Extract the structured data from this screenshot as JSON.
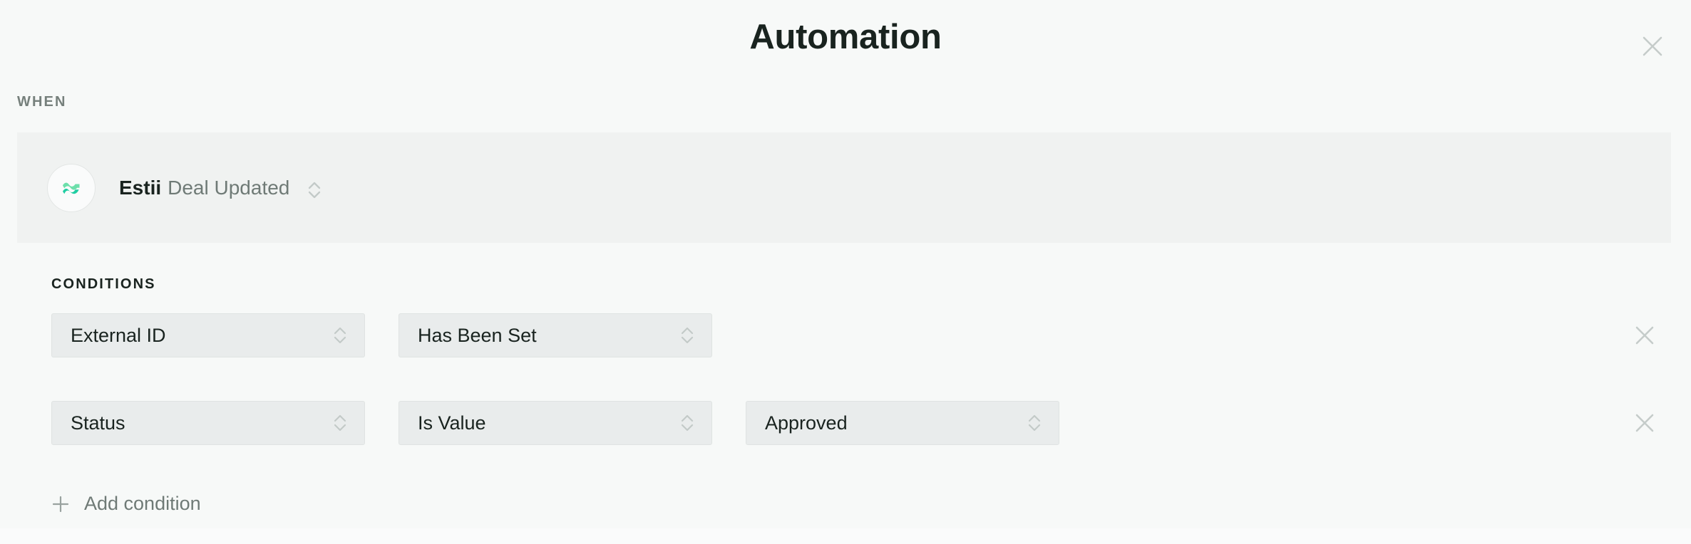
{
  "header": {
    "title": "Automation",
    "close_icon": "close-icon"
  },
  "when_section": {
    "label": "WHEN",
    "trigger": {
      "app_icon": "estii-waves-logo-icon",
      "app_name": "Estii",
      "event_name": "Deal Updated",
      "selector_icon": "chevron-up-down-icon"
    }
  },
  "conditions_section": {
    "label": "CONDITIONS",
    "rows": [
      {
        "field": "External ID",
        "operator": "Has Been Set",
        "value": null,
        "remove_icon": "close-icon"
      },
      {
        "field": "Status",
        "operator": "Is Value",
        "value": "Approved",
        "remove_icon": "close-icon"
      }
    ],
    "add_label": "Add condition",
    "add_icon": "plus-icon"
  },
  "colors": {
    "page_background": "#f7f9f8",
    "band_background": "#f0f2f1",
    "select_background": "#e9ecec",
    "select_border": "#dfe3e2",
    "text_primary": "#19231f",
    "text_muted": "#6f7a76",
    "icon_muted": "#c3cac8",
    "logo_wave_light": "#6ddfab",
    "logo_wave_dark": "#1fcda2"
  }
}
